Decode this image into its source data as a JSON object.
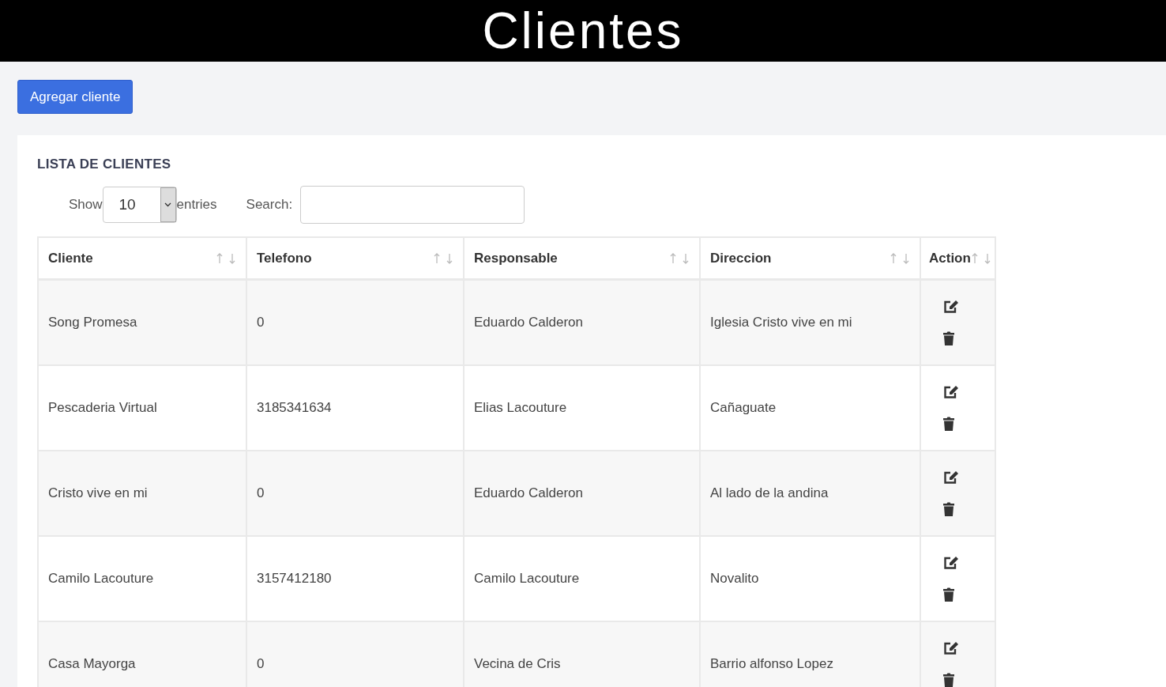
{
  "header": {
    "title": "Clientes"
  },
  "add_button": "Agregar cliente",
  "card": {
    "title": "LISTA DE CLIENTES",
    "length": {
      "before": "Show",
      "value": "10",
      "after": "entries"
    },
    "search": {
      "label": "Search:"
    },
    "table": {
      "columns": [
        "Cliente",
        "Telefono",
        "Responsable",
        "Direccion",
        "Action"
      ],
      "rows": [
        {
          "cells": [
            "Song Promesa",
            "0",
            "Eduardo Calderon",
            "Iglesia Cristo vive en mi"
          ]
        },
        {
          "cells": [
            "Pescaderia Virtual",
            "3185341634",
            "Elias Lacouture",
            "Cañaguate"
          ]
        },
        {
          "cells": [
            "Cristo vive en mi",
            "0",
            "Eduardo Calderon",
            "Al lado de la andina"
          ]
        },
        {
          "cells": [
            "Camilo Lacouture",
            "3157412180",
            "Camilo Lacouture",
            "Novalito"
          ]
        },
        {
          "cells": [
            "Casa Mayorga",
            "0",
            "Vecina de Cris",
            "Barrio alfonso Lopez"
          ]
        }
      ]
    }
  }
}
